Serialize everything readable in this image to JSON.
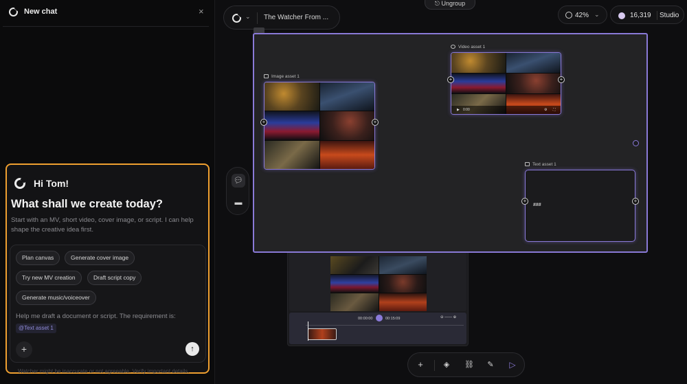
{
  "chat": {
    "title": "New chat",
    "close_icon": "×",
    "greeting": "Hi Tom!",
    "headline": "What shall we create today?",
    "subtext": "Start with an MV, short video, cover image, or script. I can help shape the creative idea first.",
    "chips": [
      "Plan canvas",
      "Generate cover image",
      "Try new MV creation",
      "Draft script copy",
      "Generate music/voiceover"
    ],
    "prompt": "Help me draft a document or script. The requirement is:",
    "mention": "@Text asset 1",
    "add_icon": "+",
    "send_icon": "↑",
    "footnote": "Watcher might be inaccurate or not agreeable. Verify important details."
  },
  "topbar": {
    "ungroup_label": "Ungroup",
    "project_title": "The Watcher From ...",
    "zoom": "42%",
    "credits": "16,319",
    "studio_label": "Studio"
  },
  "canvas": {
    "image_asset_label": "Image asset 1",
    "video_asset_label": "Video asset 1",
    "text_asset_label": "Text asset 1",
    "text_asset_content": "###",
    "video_time": "0:00"
  },
  "timeline": {
    "current_time": "00:00:00",
    "total_time": "00:15:09"
  },
  "icons": {
    "side_tools": [
      "chat-bubble-icon",
      "folder-icon"
    ],
    "bottom_bar": [
      "add-icon",
      "layers-icon",
      "link-icon",
      "edit-map-icon",
      "play-circle-icon"
    ]
  },
  "colors": {
    "accent": "#8a7ad8",
    "highlight_border": "#f0a030",
    "background": "#0b0b0c"
  }
}
